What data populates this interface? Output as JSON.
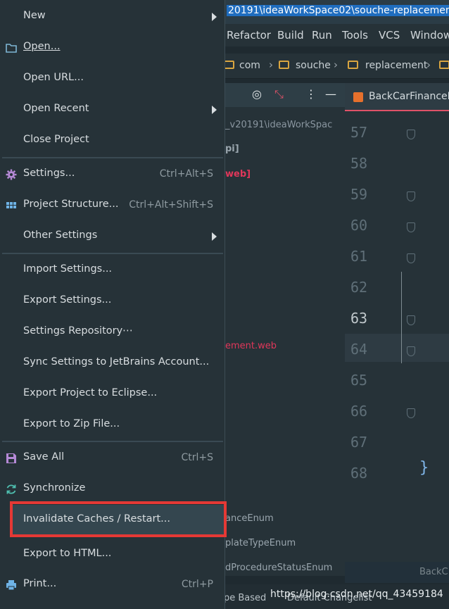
{
  "window": {
    "title": "20191\\ideaWorkSpace02\\souche-replacemen"
  },
  "menubar": [
    "Refactor",
    "Build",
    "Run",
    "Tools",
    "VCS",
    "Window"
  ],
  "breadcrumb": [
    "com",
    "souche",
    "replacement"
  ],
  "project_panel": {
    "lines": [
      {
        "text": "_v20191\\ideaWorkSpac",
        "color": "#8a96a0"
      },
      {
        "text": "pi]",
        "color": "#9aa6ae"
      },
      {
        "text": "web]",
        "color": "#e0375a"
      },
      {
        "text": "ement.web",
        "color": "#e0375a"
      },
      {
        "text": "anceEnum",
        "color": "#9aa6ae"
      },
      {
        "text": "plateTypeEnum",
        "color": "#9aa6ae"
      },
      {
        "text": "dProcedureStatusEnum",
        "color": "#9aa6ae"
      }
    ]
  },
  "editor": {
    "tab_label": "BackCarFinanceE",
    "line_numbers": [
      "57",
      "58",
      "59",
      "60",
      "61",
      "62",
      "63",
      "64",
      "65",
      "66",
      "67",
      "68"
    ],
    "current_line": "63",
    "brace": "}",
    "status_label": "BackC"
  },
  "statusbar": {
    "left": "pe Based",
    "right": "Default Changelist"
  },
  "watermark": "https://blog.csdn.net/qq_43459184",
  "menu": {
    "items": [
      {
        "label": "New",
        "submenu": true
      },
      {
        "label": "Open...",
        "icon": "folder-icon"
      },
      {
        "label": "Open URL..."
      },
      {
        "label": "Open Recent",
        "submenu": true
      },
      {
        "label": "Close Project"
      },
      {
        "label": "Settings...",
        "shortcut": "Ctrl+Alt+S",
        "icon": "gear-icon"
      },
      {
        "label": "Project Structure...",
        "shortcut": "Ctrl+Alt+Shift+S",
        "icon": "grid-icon"
      },
      {
        "label": "Other Settings",
        "submenu": true
      },
      {
        "label": "Import Settings..."
      },
      {
        "label": "Export Settings..."
      },
      {
        "label": "Settings Repository⋯"
      },
      {
        "label": "Sync Settings to JetBrains Account..."
      },
      {
        "label": "Export Project to Eclipse..."
      },
      {
        "label": "Export to Zip File..."
      },
      {
        "label": "Save All",
        "shortcut": "Ctrl+S",
        "icon": "save-icon"
      },
      {
        "label": "Synchronize",
        "icon": "sync-icon"
      },
      {
        "label": "Invalidate Caches / Restart...",
        "highlighted": true
      },
      {
        "label": "Export to HTML..."
      },
      {
        "label": "Print...",
        "shortcut": "Ctrl+P",
        "icon": "print-icon"
      }
    ]
  },
  "colors": {
    "menu_bg": "#263238",
    "highlight": "#34464f",
    "red_outline": "#e53935",
    "accent_pink": "#e05268"
  }
}
